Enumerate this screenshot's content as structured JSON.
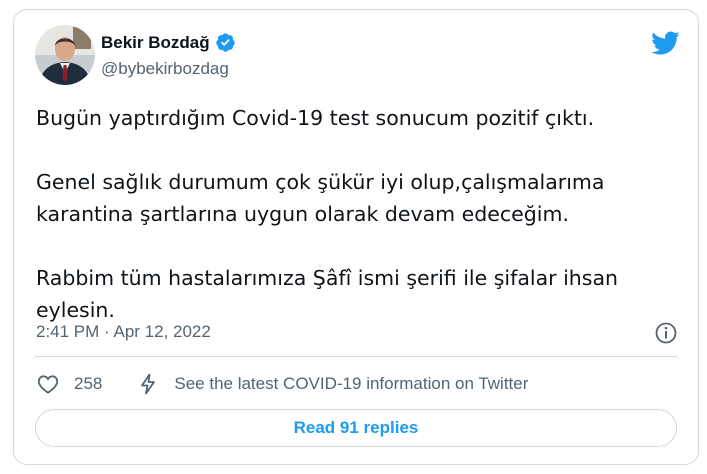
{
  "author": {
    "name": "Bekir Bozdağ",
    "handle": "@bybekirbozdag",
    "verified": true
  },
  "tweet": {
    "paragraphs": [
      "Bugün yaptırdığım Covid-19 test sonucum pozitif çıktı.",
      "Genel sağlık durumum çok şükür iyi olup,çalışmalarıma karantina şartlarına uygun olarak devam edeceğim.",
      "Rabbim tüm hastalarımıza Şâfî ismi şerifi ile şifalar ihsan eylesin."
    ]
  },
  "meta": {
    "timestamp": "2:41 PM · Apr 12, 2022"
  },
  "actions": {
    "likes": "258",
    "covid_notice": "See the latest COVID-19 information on Twitter"
  },
  "replies_button": "Read 91 replies",
  "icons": {
    "logo": "twitter-bird-icon",
    "verified": "verified-badge-icon",
    "info": "info-icon",
    "like": "heart-icon",
    "covid": "lightning-bolt-icon"
  },
  "colors": {
    "accent": "#1d9bf0",
    "text": "#0f1419",
    "secondary_text": "#536471",
    "border": "#cfd9de"
  }
}
